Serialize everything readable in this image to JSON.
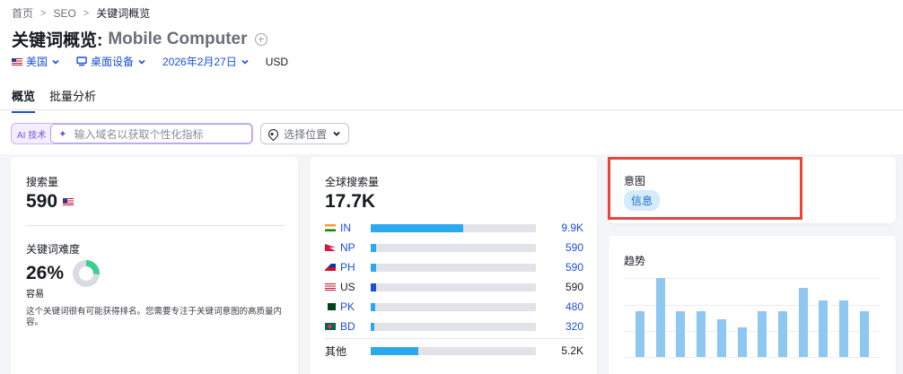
{
  "breadcrumb": {
    "home": "首页",
    "seo": "SEO",
    "current": "关键词概览",
    "sep": ">"
  },
  "page_title": {
    "prefix": "关键词概览:",
    "keyword": "Mobile Computer"
  },
  "filters": {
    "country": "美国",
    "device": "桌面设备",
    "date": "2026年2月27日",
    "currency": "USD"
  },
  "tabs": [
    "概览",
    "批量分析"
  ],
  "ai_bar": {
    "badge": "AI 技术",
    "placeholder": "输入域名以获取个性化指标",
    "location_label": "选择位置"
  },
  "volume": {
    "title": "搜索量",
    "value": "590"
  },
  "kd": {
    "title": "关键词难度",
    "value": "26%",
    "level": "容易",
    "percent": 26,
    "description": "这个关键词很有可能获得排名。您需要专注于关键词意图的高质量内容。"
  },
  "global_volume": {
    "title": "全球搜索量",
    "value": "17.7K",
    "countries": [
      {
        "code": "IN",
        "value": "9.9K",
        "share": 0.56,
        "link": true,
        "flag": "india-flag"
      },
      {
        "code": "NP",
        "value": "590",
        "share": 0.033,
        "link": true,
        "flag": "nepal-flag"
      },
      {
        "code": "PH",
        "value": "590",
        "share": 0.033,
        "link": true,
        "flag": "philippines-flag"
      },
      {
        "code": "US",
        "value": "590",
        "share": 0.033,
        "link": false,
        "flag": "usa-flag"
      },
      {
        "code": "PK",
        "value": "480",
        "share": 0.027,
        "link": true,
        "flag": "pakistan-flag"
      },
      {
        "code": "BD",
        "value": "320",
        "share": 0.018,
        "link": true,
        "flag": "bangladesh-flag"
      }
    ],
    "other": {
      "label": "其他",
      "value": "5.2K",
      "share": 0.29
    }
  },
  "intent": {
    "title": "意图",
    "badge": "信息"
  },
  "trend": {
    "title": "趋势",
    "values": [
      0.58,
      1.0,
      0.58,
      0.58,
      0.48,
      0.38,
      0.58,
      0.58,
      0.88,
      0.72,
      0.72,
      0.58
    ]
  },
  "colors": {
    "accent": "#1a4fd6",
    "bar": "#2aa8f0",
    "trend_bar": "#8ec7f0",
    "highlight": "#e8453c"
  }
}
